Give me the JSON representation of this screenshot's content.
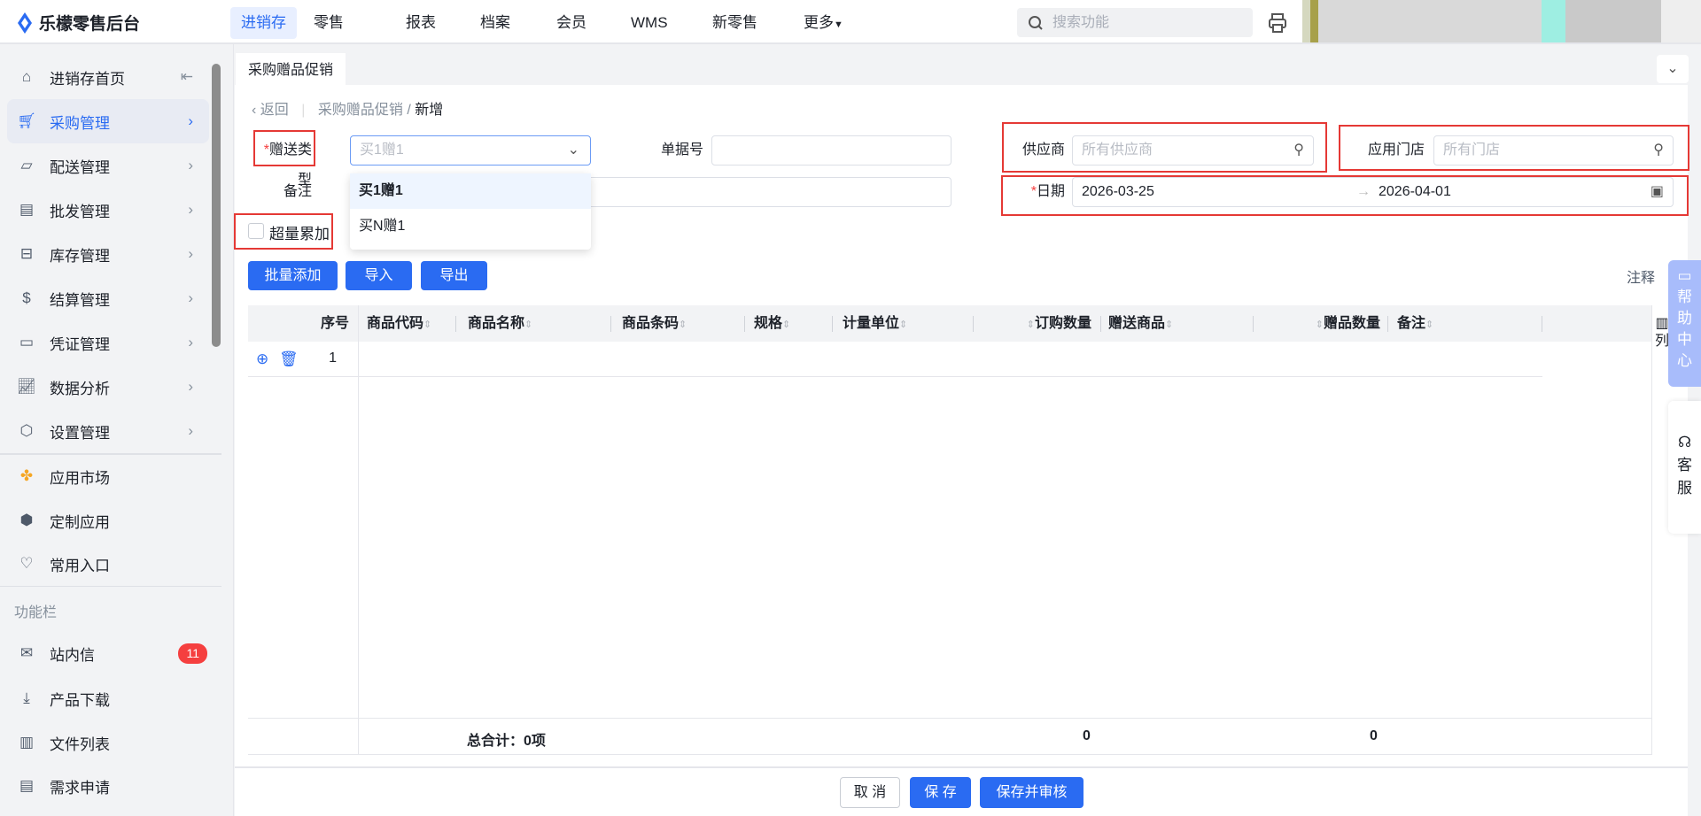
{
  "header": {
    "logo": "乐檬零售后台",
    "nav": [
      "进销存",
      "零售",
      "报表",
      "档案",
      "会员",
      "WMS",
      "新零售",
      "更多"
    ],
    "search_placeholder": "搜索功能"
  },
  "sidebar": {
    "items": [
      {
        "label": "进销存首页",
        "icon": "home-icon"
      },
      {
        "label": "采购管理",
        "icon": "cart-icon"
      },
      {
        "label": "配送管理",
        "icon": "map-icon"
      },
      {
        "label": "批发管理",
        "icon": "wholesale-icon"
      },
      {
        "label": "库存管理",
        "icon": "inbox-icon"
      },
      {
        "label": "结算管理",
        "icon": "dollar-icon"
      },
      {
        "label": "凭证管理",
        "icon": "document-icon"
      },
      {
        "label": "数据分析",
        "icon": "chart-icon"
      },
      {
        "label": "设置管理",
        "icon": "settings-icon"
      }
    ],
    "apps": [
      {
        "label": "应用市场",
        "icon": "app-market-icon"
      },
      {
        "label": "定制应用",
        "icon": "cube-icon"
      },
      {
        "label": "常用入口",
        "icon": "heart-icon"
      }
    ],
    "section_title": "功能栏",
    "tools": [
      {
        "label": "站内信",
        "icon": "mail-icon",
        "badge": "11"
      },
      {
        "label": "产品下载",
        "icon": "download-icon"
      },
      {
        "label": "文件列表",
        "icon": "file-list-icon"
      },
      {
        "label": "需求申请",
        "icon": "request-icon"
      }
    ]
  },
  "tab": "采购赠品促销",
  "breadcrumb": {
    "back": "返回",
    "parent": "采购赠品促销",
    "current": "新增"
  },
  "form": {
    "gift_type_label": "赠送类型",
    "gift_type_value": "买1赠1",
    "doc_no_label": "单据号",
    "doc_no_value": "",
    "supplier_label": "供应商",
    "supplier_placeholder": "所有供应商",
    "store_label": "应用门店",
    "store_placeholder": "所有门店",
    "remark_label": "备注",
    "date_label": "日期",
    "date_start": "2026-03-25",
    "date_end": "2026-04-01",
    "overflow_label": "超量累加",
    "dropdown_options": [
      "买1赠1",
      "买N赠1"
    ]
  },
  "toolbar": {
    "batch_add": "批量添加",
    "import": "导入",
    "export": "导出",
    "notes": "注释"
  },
  "table": {
    "columns": [
      "序号",
      "商品代码",
      "商品名称",
      "商品条码",
      "规格",
      "计量单位",
      "订购数量",
      "赠送商品",
      "赠品数量",
      "备注"
    ],
    "column_setting": "列",
    "rows": [
      {
        "index": "1"
      }
    ],
    "total_label": "总合计：0项",
    "total_order_qty": "0",
    "total_gift_qty": "0"
  },
  "float": {
    "help": "帮助中心",
    "service": "客服"
  },
  "footer": {
    "cancel": "取 消",
    "save": "保 存",
    "save_audit": "保存并审核"
  }
}
